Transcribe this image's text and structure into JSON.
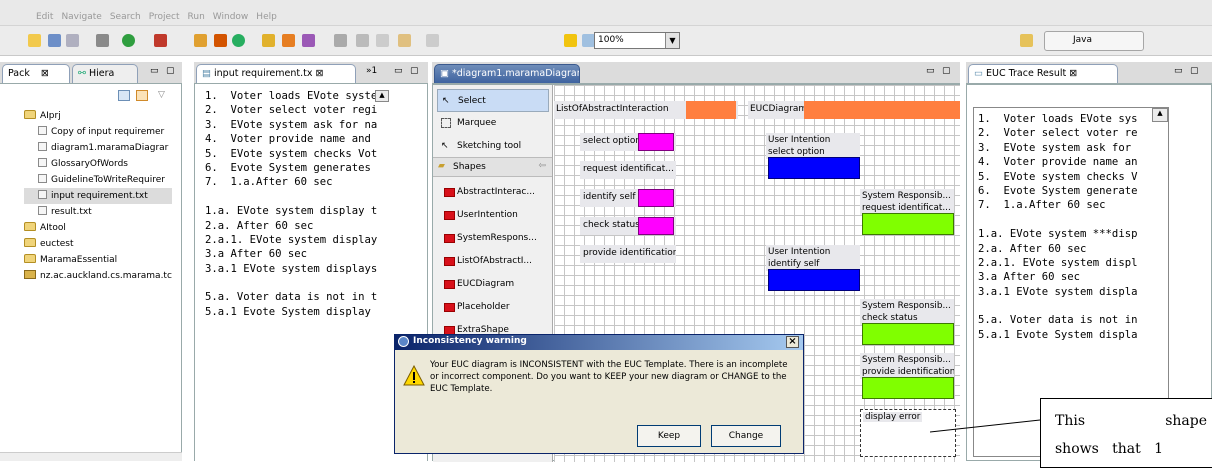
{
  "menubar": {
    "items": [
      "Edit",
      "Navigate",
      "Search",
      "Project",
      "Run",
      "Window",
      "Help"
    ]
  },
  "toolbar": {
    "zoom": "100%",
    "perspective": "Java"
  },
  "left_panel": {
    "tab1": "Pack",
    "tab2": "Hiera",
    "tree": [
      {
        "label": "AIprj",
        "icon": "project-folder",
        "indent": 0
      },
      {
        "label": "Copy of input requiremer",
        "icon": "file",
        "indent": 1
      },
      {
        "label": "diagram1.maramaDiagrar",
        "icon": "diagram-file",
        "indent": 1
      },
      {
        "label": "GlossaryOfWords",
        "icon": "file",
        "indent": 1
      },
      {
        "label": "GuidelineToWriteRequirer",
        "icon": "file",
        "indent": 1
      },
      {
        "label": "input requirement.txt",
        "icon": "file",
        "indent": 1,
        "selected": true
      },
      {
        "label": "result.txt",
        "icon": "file",
        "indent": 1
      },
      {
        "label": "AItool",
        "icon": "project-folder",
        "indent": 0
      },
      {
        "label": "euctest",
        "icon": "project-folder",
        "indent": 0
      },
      {
        "label": "MaramaEssential",
        "icon": "project-folder",
        "indent": 0
      },
      {
        "label": "nz.ac.auckland.cs.marama.tc",
        "icon": "package",
        "indent": 0
      }
    ]
  },
  "editor": {
    "tab": "input requirement.tx",
    "overflow": "»1",
    "lines": [
      "1.  Voter loads EVote syste",
      "2.  Voter select voter regi",
      "3.  EVote system ask for na",
      "4.  Voter provide name and",
      "5.  EVote system checks Vot",
      "6.  Evote System generates",
      "7.  1.a.After 60 sec",
      "",
      "1.a. EVote system display t",
      "2.a. After 60 sec",
      "2.a.1. EVote system display",
      "3.a After 60 sec",
      "3.a.1 EVote system displays",
      "",
      "5.a. Voter data is not in t",
      "5.a.1 Evote System display"
    ]
  },
  "diagram": {
    "tab": "*diagram1.maramaDiagram",
    "palette": {
      "tools": [
        "Select",
        "Marquee",
        "Sketching tool"
      ],
      "drawer": "Shapes",
      "shapes": [
        "AbstractInterac...",
        "UserIntention",
        "SystemRespons...",
        "ListOfAbstractI...",
        "EUCDiagram",
        "Placeholder",
        "ExtraShape"
      ]
    },
    "headers": {
      "list": "ListOfAbstractInteraction",
      "euc": "EUCDiagram"
    },
    "abstract_items": [
      "select option",
      "request identificat...",
      "identify self",
      "check status",
      "provide identification"
    ],
    "intentions": [
      {
        "title": "User Intention",
        "sub": "select option"
      },
      {
        "title": "User Intention",
        "sub": "identify self"
      }
    ],
    "responsibilities": [
      {
        "title": "System Responsib...",
        "sub": "request identificat..."
      },
      {
        "title": "System Responsib...",
        "sub": "check status"
      },
      {
        "title": "System Responsib...",
        "sub": "provide identification"
      }
    ],
    "placeholder": "display error"
  },
  "trace": {
    "tab": "EUC Trace Result",
    "lines": [
      "1.  Voter loads EVote sys",
      "2.  Voter select voter re",
      "3.  EVote system ask for",
      "4.  Voter provide name an",
      "5.  EVote system checks V",
      "6.  Evote System generate",
      "7.  1.a.After 60 sec",
      "",
      "1.a. EVote system ***disp",
      "2.a. After 60 sec",
      "2.a.1. EVote system displ",
      "3.a After 60 sec",
      "3.a.1 EVote system displa",
      "",
      "5.a. Voter data is not in",
      "5.a.1 Evote System displa"
    ]
  },
  "dialog": {
    "title": "Inconsistency warning",
    "message": "Your EUC diagram is INCONSISTENT with the EUC Template. There is an incomplete or incorrect component. Do you want to KEEP your new diagram or CHANGE to the EUC Template.",
    "keep": "Keep",
    "change": "Change",
    "close": "×"
  },
  "callout": {
    "line1a": "This",
    "line1b": "shape",
    "line2": "shows   that   1"
  },
  "colors": {
    "orange": "#ff7f3f",
    "magenta": "#ff00ff",
    "blue": "#0000ff",
    "green": "#80ff00"
  }
}
